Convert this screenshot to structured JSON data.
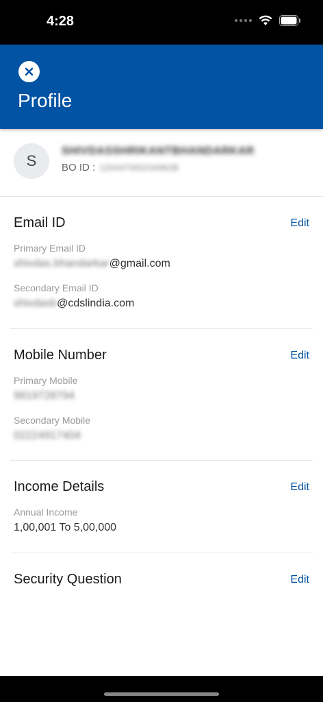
{
  "status_bar": {
    "time": "4:28"
  },
  "header": {
    "title": "Profile"
  },
  "profile": {
    "avatar_initial": "S",
    "name": "SHIVDASSHRIKANTBHANDARKAR",
    "bo_label": "BO ID :",
    "bo_value": "1204470002349638"
  },
  "email": {
    "title": "Email ID",
    "edit": "Edit",
    "primary_label": "Primary Email ID",
    "primary_user": "shivdas.bhandarkar",
    "primary_domain": "@gmail.com",
    "secondary_label": "Secondary Email ID",
    "secondary_user": "shivdasb",
    "secondary_domain": "@cdslindia.com"
  },
  "mobile": {
    "title": "Mobile Number",
    "edit": "Edit",
    "primary_label": "Primary Mobile",
    "primary_value": "9819728794",
    "secondary_label": "Secondary Mobile",
    "secondary_value": "02224917404"
  },
  "income": {
    "title": "Income Details",
    "edit": "Edit",
    "annual_label": "Annual Income",
    "annual_value": "1,00,001 To 5,00,000"
  },
  "security": {
    "title": "Security Question",
    "edit": "Edit"
  }
}
